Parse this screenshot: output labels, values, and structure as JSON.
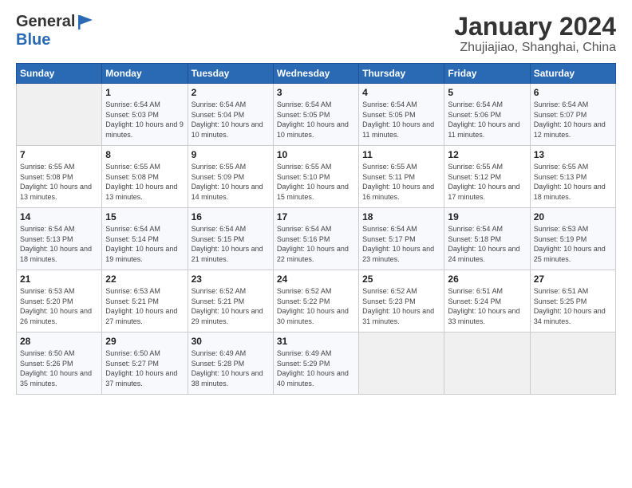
{
  "header": {
    "logo_general": "General",
    "logo_blue": "Blue",
    "title": "January 2024",
    "location": "Zhujiajiao, Shanghai, China"
  },
  "weekdays": [
    "Sunday",
    "Monday",
    "Tuesday",
    "Wednesday",
    "Thursday",
    "Friday",
    "Saturday"
  ],
  "weeks": [
    [
      {
        "day": "",
        "sunrise": "",
        "sunset": "",
        "daylight": ""
      },
      {
        "day": "1",
        "sunrise": "Sunrise: 6:54 AM",
        "sunset": "Sunset: 5:03 PM",
        "daylight": "Daylight: 10 hours and 9 minutes."
      },
      {
        "day": "2",
        "sunrise": "Sunrise: 6:54 AM",
        "sunset": "Sunset: 5:04 PM",
        "daylight": "Daylight: 10 hours and 10 minutes."
      },
      {
        "day": "3",
        "sunrise": "Sunrise: 6:54 AM",
        "sunset": "Sunset: 5:05 PM",
        "daylight": "Daylight: 10 hours and 10 minutes."
      },
      {
        "day": "4",
        "sunrise": "Sunrise: 6:54 AM",
        "sunset": "Sunset: 5:05 PM",
        "daylight": "Daylight: 10 hours and 11 minutes."
      },
      {
        "day": "5",
        "sunrise": "Sunrise: 6:54 AM",
        "sunset": "Sunset: 5:06 PM",
        "daylight": "Daylight: 10 hours and 11 minutes."
      },
      {
        "day": "6",
        "sunrise": "Sunrise: 6:54 AM",
        "sunset": "Sunset: 5:07 PM",
        "daylight": "Daylight: 10 hours and 12 minutes."
      }
    ],
    [
      {
        "day": "7",
        "sunrise": "Sunrise: 6:55 AM",
        "sunset": "Sunset: 5:08 PM",
        "daylight": "Daylight: 10 hours and 13 minutes."
      },
      {
        "day": "8",
        "sunrise": "Sunrise: 6:55 AM",
        "sunset": "Sunset: 5:08 PM",
        "daylight": "Daylight: 10 hours and 13 minutes."
      },
      {
        "day": "9",
        "sunrise": "Sunrise: 6:55 AM",
        "sunset": "Sunset: 5:09 PM",
        "daylight": "Daylight: 10 hours and 14 minutes."
      },
      {
        "day": "10",
        "sunrise": "Sunrise: 6:55 AM",
        "sunset": "Sunset: 5:10 PM",
        "daylight": "Daylight: 10 hours and 15 minutes."
      },
      {
        "day": "11",
        "sunrise": "Sunrise: 6:55 AM",
        "sunset": "Sunset: 5:11 PM",
        "daylight": "Daylight: 10 hours and 16 minutes."
      },
      {
        "day": "12",
        "sunrise": "Sunrise: 6:55 AM",
        "sunset": "Sunset: 5:12 PM",
        "daylight": "Daylight: 10 hours and 17 minutes."
      },
      {
        "day": "13",
        "sunrise": "Sunrise: 6:55 AM",
        "sunset": "Sunset: 5:13 PM",
        "daylight": "Daylight: 10 hours and 18 minutes."
      }
    ],
    [
      {
        "day": "14",
        "sunrise": "Sunrise: 6:54 AM",
        "sunset": "Sunset: 5:13 PM",
        "daylight": "Daylight: 10 hours and 18 minutes."
      },
      {
        "day": "15",
        "sunrise": "Sunrise: 6:54 AM",
        "sunset": "Sunset: 5:14 PM",
        "daylight": "Daylight: 10 hours and 19 minutes."
      },
      {
        "day": "16",
        "sunrise": "Sunrise: 6:54 AM",
        "sunset": "Sunset: 5:15 PM",
        "daylight": "Daylight: 10 hours and 21 minutes."
      },
      {
        "day": "17",
        "sunrise": "Sunrise: 6:54 AM",
        "sunset": "Sunset: 5:16 PM",
        "daylight": "Daylight: 10 hours and 22 minutes."
      },
      {
        "day": "18",
        "sunrise": "Sunrise: 6:54 AM",
        "sunset": "Sunset: 5:17 PM",
        "daylight": "Daylight: 10 hours and 23 minutes."
      },
      {
        "day": "19",
        "sunrise": "Sunrise: 6:54 AM",
        "sunset": "Sunset: 5:18 PM",
        "daylight": "Daylight: 10 hours and 24 minutes."
      },
      {
        "day": "20",
        "sunrise": "Sunrise: 6:53 AM",
        "sunset": "Sunset: 5:19 PM",
        "daylight": "Daylight: 10 hours and 25 minutes."
      }
    ],
    [
      {
        "day": "21",
        "sunrise": "Sunrise: 6:53 AM",
        "sunset": "Sunset: 5:20 PM",
        "daylight": "Daylight: 10 hours and 26 minutes."
      },
      {
        "day": "22",
        "sunrise": "Sunrise: 6:53 AM",
        "sunset": "Sunset: 5:21 PM",
        "daylight": "Daylight: 10 hours and 27 minutes."
      },
      {
        "day": "23",
        "sunrise": "Sunrise: 6:52 AM",
        "sunset": "Sunset: 5:21 PM",
        "daylight": "Daylight: 10 hours and 29 minutes."
      },
      {
        "day": "24",
        "sunrise": "Sunrise: 6:52 AM",
        "sunset": "Sunset: 5:22 PM",
        "daylight": "Daylight: 10 hours and 30 minutes."
      },
      {
        "day": "25",
        "sunrise": "Sunrise: 6:52 AM",
        "sunset": "Sunset: 5:23 PM",
        "daylight": "Daylight: 10 hours and 31 minutes."
      },
      {
        "day": "26",
        "sunrise": "Sunrise: 6:51 AM",
        "sunset": "Sunset: 5:24 PM",
        "daylight": "Daylight: 10 hours and 33 minutes."
      },
      {
        "day": "27",
        "sunrise": "Sunrise: 6:51 AM",
        "sunset": "Sunset: 5:25 PM",
        "daylight": "Daylight: 10 hours and 34 minutes."
      }
    ],
    [
      {
        "day": "28",
        "sunrise": "Sunrise: 6:50 AM",
        "sunset": "Sunset: 5:26 PM",
        "daylight": "Daylight: 10 hours and 35 minutes."
      },
      {
        "day": "29",
        "sunrise": "Sunrise: 6:50 AM",
        "sunset": "Sunset: 5:27 PM",
        "daylight": "Daylight: 10 hours and 37 minutes."
      },
      {
        "day": "30",
        "sunrise": "Sunrise: 6:49 AM",
        "sunset": "Sunset: 5:28 PM",
        "daylight": "Daylight: 10 hours and 38 minutes."
      },
      {
        "day": "31",
        "sunrise": "Sunrise: 6:49 AM",
        "sunset": "Sunset: 5:29 PM",
        "daylight": "Daylight: 10 hours and 40 minutes."
      },
      {
        "day": "",
        "sunrise": "",
        "sunset": "",
        "daylight": ""
      },
      {
        "day": "",
        "sunrise": "",
        "sunset": "",
        "daylight": ""
      },
      {
        "day": "",
        "sunrise": "",
        "sunset": "",
        "daylight": ""
      }
    ]
  ]
}
